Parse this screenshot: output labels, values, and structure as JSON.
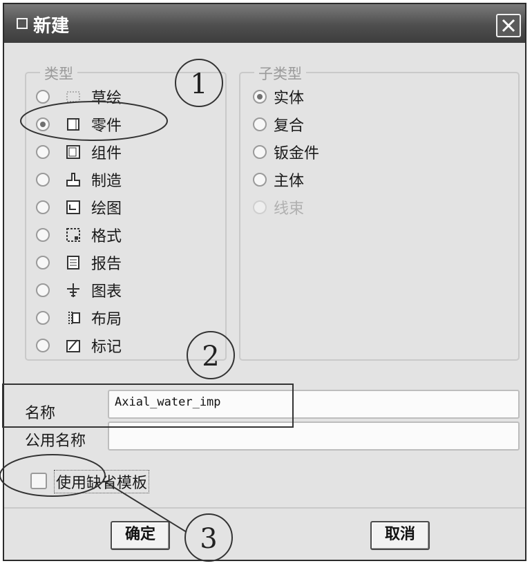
{
  "dialog": {
    "title": "新建",
    "close_icon": "close-x-icon"
  },
  "type_group": {
    "legend": "类型",
    "items": [
      {
        "label": "草绘",
        "icon": "sketch-icon",
        "selected": false
      },
      {
        "label": "零件",
        "icon": "part-icon",
        "selected": true
      },
      {
        "label": "组件",
        "icon": "assembly-icon",
        "selected": false
      },
      {
        "label": "制造",
        "icon": "manufacturing-icon",
        "selected": false
      },
      {
        "label": "绘图",
        "icon": "drawing-icon",
        "selected": false
      },
      {
        "label": "格式",
        "icon": "format-icon",
        "selected": false
      },
      {
        "label": "报告",
        "icon": "report-icon",
        "selected": false
      },
      {
        "label": "图表",
        "icon": "diagram-icon",
        "selected": false
      },
      {
        "label": "布局",
        "icon": "layout-icon",
        "selected": false
      },
      {
        "label": "标记",
        "icon": "markup-icon",
        "selected": false
      }
    ]
  },
  "subtype_group": {
    "legend": "子类型",
    "items": [
      {
        "label": "实体",
        "selected": true,
        "enabled": true
      },
      {
        "label": "复合",
        "selected": false,
        "enabled": true
      },
      {
        "label": "钣金件",
        "selected": false,
        "enabled": true
      },
      {
        "label": "主体",
        "selected": false,
        "enabled": true
      },
      {
        "label": "线束",
        "selected": false,
        "enabled": false
      }
    ]
  },
  "name_field": {
    "label": "名称",
    "value": "Axial_water_imp"
  },
  "common_name_field": {
    "label": "公用名称",
    "value": ""
  },
  "template_checkbox": {
    "label": "使用缺省模板",
    "checked": false
  },
  "buttons": {
    "ok": "确定",
    "cancel": "取消"
  },
  "annotations": {
    "one": "1",
    "two": "2",
    "three": "3"
  }
}
